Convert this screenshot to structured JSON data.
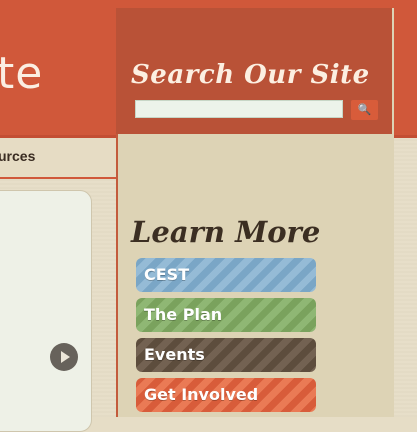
{
  "header": {
    "site_title_fragment": "te"
  },
  "nav": {
    "partial_label": "urces"
  },
  "sidebar": {
    "search": {
      "title": "Search Our Site",
      "placeholder": "",
      "button_icon": "search-icon"
    },
    "learn_more": {
      "title": "Learn More",
      "items": [
        {
          "label": "CEST",
          "color": "#7aa6c6"
        },
        {
          "label": "The Plan",
          "color": "#7aa25d"
        },
        {
          "label": "Events",
          "color": "#5d4d3d"
        },
        {
          "label": "Get Involved",
          "color": "#d85c3a"
        }
      ]
    }
  },
  "colors": {
    "brand_red": "#d0583a",
    "sidebar_header": "#b95237",
    "paper": "#e7dec8"
  }
}
